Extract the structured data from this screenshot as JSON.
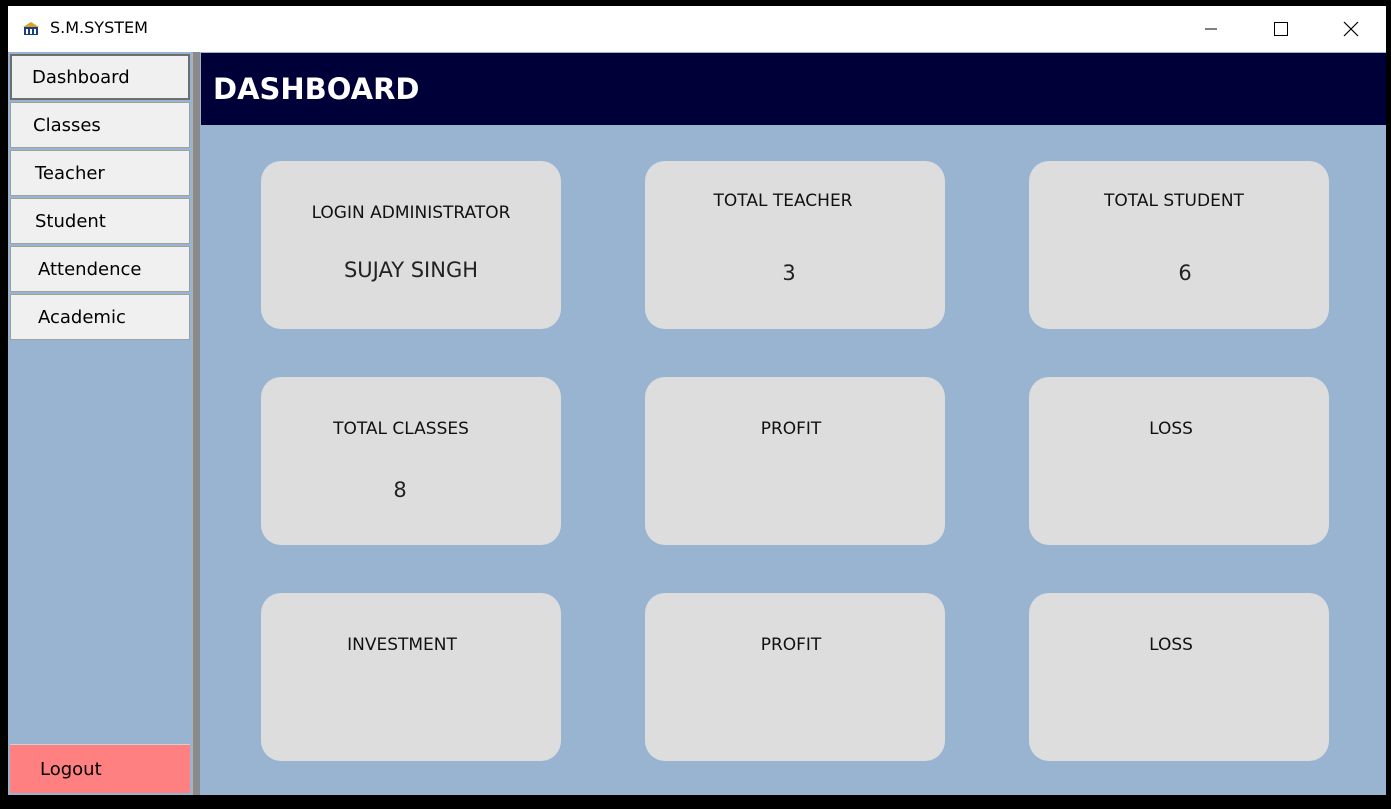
{
  "window": {
    "title": "S.M.SYSTEM",
    "controls": {
      "minimize_icon": "minimize-icon",
      "maximize_icon": "maximize-icon",
      "close_icon": "close-icon"
    }
  },
  "sidebar": {
    "items": [
      {
        "label": "Dashboard",
        "active": true
      },
      {
        "label": "Classes"
      },
      {
        "label": "Teacher"
      },
      {
        "label": "Student"
      },
      {
        "label": "Attendence"
      },
      {
        "label": "Academic"
      }
    ],
    "logout_label": "Logout"
  },
  "header": {
    "title": "DASHBOARD"
  },
  "cards": [
    {
      "label": "LOGIN ADMINISTRATOR",
      "value": "SUJAY SINGH"
    },
    {
      "label": "TOTAL TEACHER",
      "value": "3"
    },
    {
      "label": "TOTAL STUDENT",
      "value": "6"
    },
    {
      "label": "TOTAL CLASSES",
      "value": "8"
    },
    {
      "label": "PROFIT",
      "value": ""
    },
    {
      "label": "LOSS",
      "value": ""
    },
    {
      "label": "INVESTMENT",
      "value": ""
    },
    {
      "label": "PROFIT",
      "value": ""
    },
    {
      "label": "LOSS",
      "value": ""
    }
  ],
  "colors": {
    "header_bg": "#000039",
    "content_bg": "#99b4d1",
    "card_bg": "#dddddd",
    "logout_bg": "#ff8080",
    "nav_bg": "#f0f0f0"
  }
}
